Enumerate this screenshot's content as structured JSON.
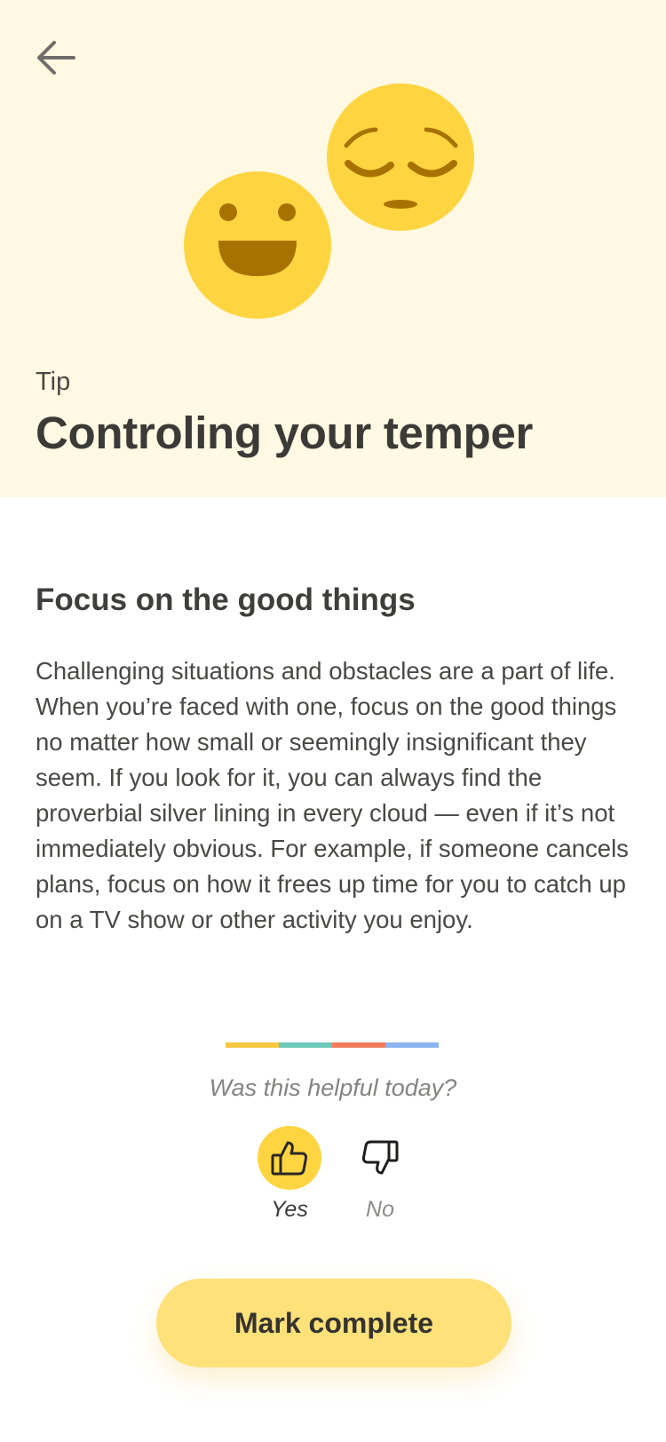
{
  "colors": {
    "hero_background": "#fff8e2",
    "emoji_face": "#fed540",
    "emoji_feature": "#a87200",
    "cta_background": "#ffe17a",
    "divider": [
      "#f5c842",
      "#6cc9b8",
      "#f17b5e",
      "#8ab4f0"
    ]
  },
  "header": {
    "back_icon": "arrow-left-icon",
    "illustration": [
      "smiling-face-icon",
      "pensive-face-icon"
    ],
    "eyebrow": "Tip",
    "title": "Controling your temper"
  },
  "content": {
    "heading": "Focus on the good things",
    "body": "Challenging situations and obstacles are a part of life. When you’re faced with one, focus on the good things no matter how small or seemingly insignificant they seem. If you look for it, you can always find the proverbial silver lining in every cloud — even if it’s not immediately obvious. For example, if someone cancels plans, focus on how it frees up time for you to catch up on a TV show or other activity you enjoy."
  },
  "feedback": {
    "question": "Was this helpful today?",
    "options": [
      {
        "label": "Yes",
        "icon": "thumbs-up-icon",
        "selected": true
      },
      {
        "label": "No",
        "icon": "thumbs-down-icon",
        "selected": false
      }
    ]
  },
  "cta": {
    "label": "Mark complete"
  }
}
